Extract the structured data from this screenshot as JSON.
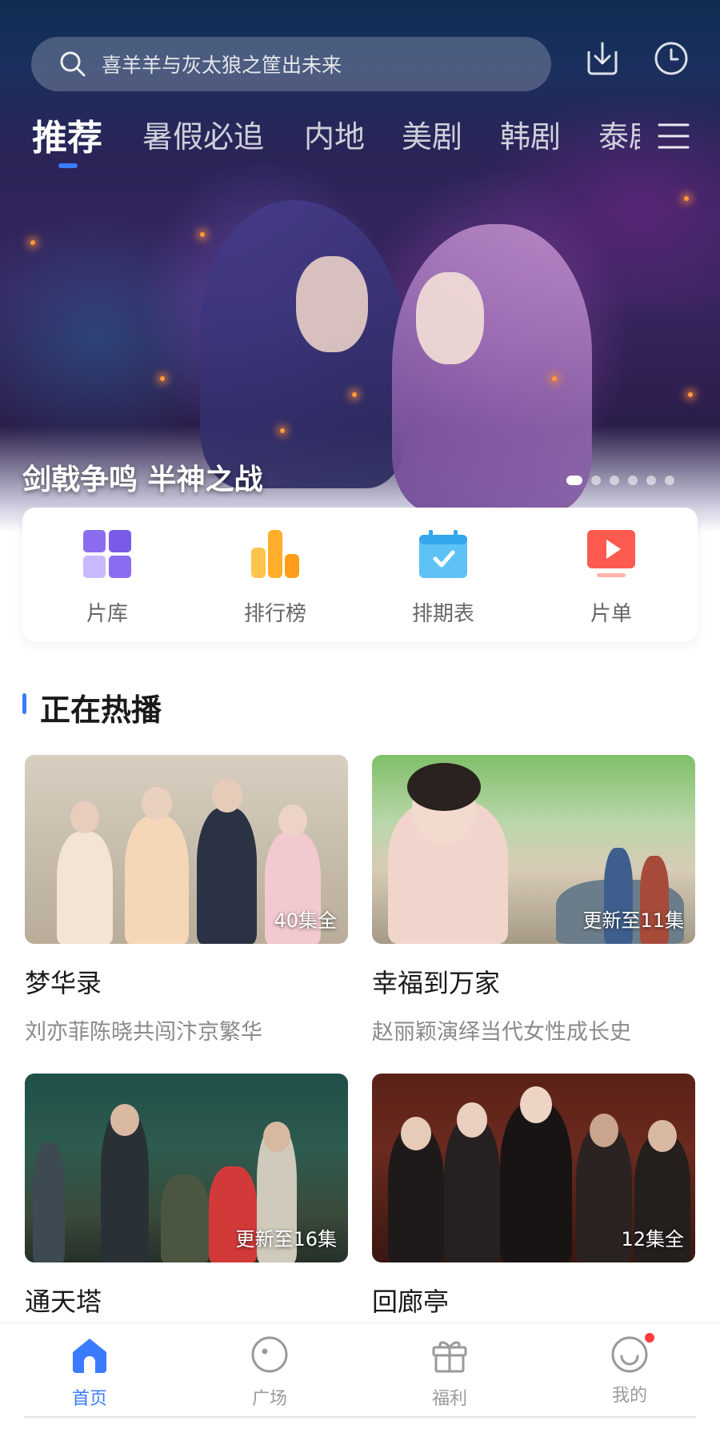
{
  "search": {
    "placeholder": "喜羊羊与灰太狼之筐出未来"
  },
  "tabs": [
    {
      "label": "推荐",
      "active": true
    },
    {
      "label": "暑假必追"
    },
    {
      "label": "内地"
    },
    {
      "label": "美剧"
    },
    {
      "label": "韩剧"
    },
    {
      "label": "泰剧"
    }
  ],
  "hero": {
    "title": "剑戟争鸣 半神之战",
    "slide_count": 6,
    "active_slide": 1
  },
  "quick_entries": [
    {
      "label": "片库",
      "icon": "library-icon"
    },
    {
      "label": "排行榜",
      "icon": "ranking-icon"
    },
    {
      "label": "排期表",
      "icon": "calendar-icon"
    },
    {
      "label": "片单",
      "icon": "playlist-icon"
    }
  ],
  "section": {
    "title": "正在热播"
  },
  "cards": [
    {
      "title": "梦华录",
      "subtitle": "刘亦菲陈晓共闯汴京繁华",
      "badge": "40集全"
    },
    {
      "title": "幸福到万家",
      "subtitle": "赵丽颖演绎当代女性成长史",
      "badge": "更新至11集"
    },
    {
      "title": "通天塔",
      "subtitle": "",
      "badge": "更新至16集"
    },
    {
      "title": "回廊亭",
      "subtitle": "",
      "badge": "12集全"
    }
  ],
  "bottom_nav": [
    {
      "label": "首页",
      "icon": "home-icon",
      "active": true
    },
    {
      "label": "广场",
      "icon": "square-icon"
    },
    {
      "label": "福利",
      "icon": "gift-icon"
    },
    {
      "label": "我的",
      "icon": "profile-icon",
      "has_notification": true
    }
  ],
  "colors": {
    "accent": "#3b7bff",
    "notification": "#ff3b3b"
  }
}
